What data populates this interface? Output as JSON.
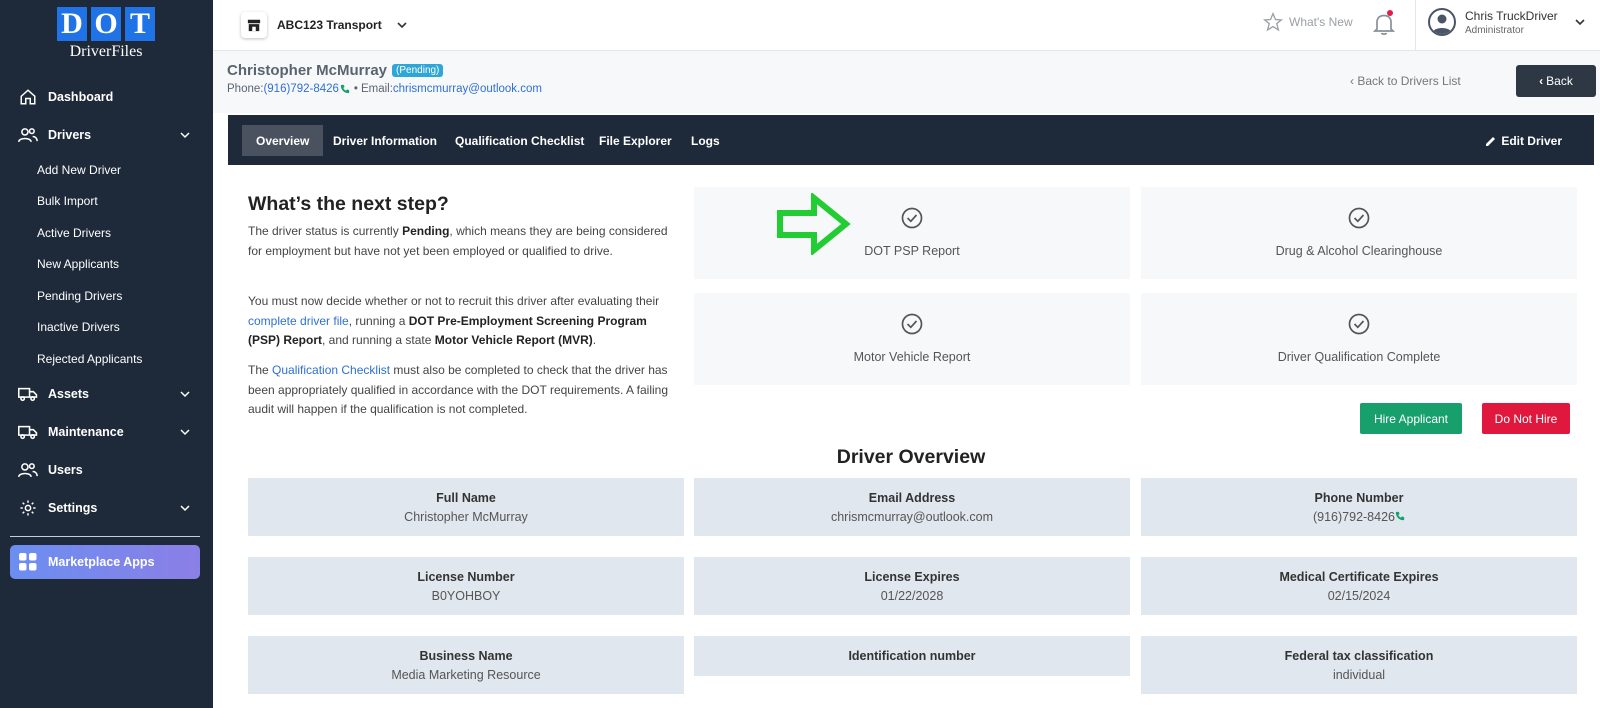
{
  "brand": {
    "letters": [
      "D",
      "O",
      "T"
    ],
    "sub": "DriverFiles"
  },
  "sidebar": {
    "dashboard": "Dashboard",
    "drivers": "Drivers",
    "drivers_sub": [
      "Add New Driver",
      "Bulk Import",
      "Active Drivers",
      "New Applicants",
      "Pending Drivers",
      "Inactive Drivers",
      "Rejected Applicants"
    ],
    "assets": "Assets",
    "maintenance": "Maintenance",
    "users": "Users",
    "settings": "Settings",
    "marketplace": "Marketplace Apps"
  },
  "topbar": {
    "company": "ABC123 Transport",
    "whats_new": "What's New",
    "user_name": "Chris TruckDriver",
    "user_role": "Administrator"
  },
  "driver": {
    "name": "Christopher McMurray",
    "status": "(Pending)",
    "phone_label": "Phone:",
    "phone": "(916)792-8426",
    "email_label": "Email:",
    "email": "chrismcmurray@outlook.com",
    "separator": "•"
  },
  "header": {
    "back_list": "Back to Drivers List",
    "back": "Back"
  },
  "tabs": [
    "Overview",
    "Driver Information",
    "Qualification Checklist",
    "File Explorer",
    "Logs"
  ],
  "edit_driver": "Edit Driver",
  "next_step": {
    "title": "What’s the next step?",
    "p1_a": "The driver status is currently ",
    "p1_b": "Pending",
    "p1_c": ", which means they are being considered for employment but have not yet been employed or qualified to drive.",
    "p2_a": "You must now decide whether or not to recruit this driver after evaluating their ",
    "p2_link": "complete driver file",
    "p2_b": ", running a ",
    "p2_bold1": "DOT Pre-Employment Screening Program (PSP) Report",
    "p2_c": ", and running a state ",
    "p2_bold2": "Motor Vehicle Report (MVR)",
    "p2_d": ".",
    "p3_a": "The ",
    "p3_link": "Qualification Checklist",
    "p3_b": " must also be completed to check that the driver has been appropriately qualified in accordance with the DOT requirements. A failing audit will happen if the qualification is not completed."
  },
  "steps": [
    "DOT PSP Report",
    "Drug & Alcohol Clearinghouse",
    "Motor Vehicle Report",
    "Driver Qualification Complete"
  ],
  "actions": {
    "hire": "Hire Applicant",
    "no_hire": "Do Not Hire"
  },
  "overview": {
    "title": "Driver Overview",
    "fields": [
      {
        "label": "Full Name",
        "value": "Christopher McMurray"
      },
      {
        "label": "Email Address",
        "value": "chrismcmurray@outlook.com"
      },
      {
        "label": "Phone Number",
        "value": "(916)792-8426"
      },
      {
        "label": "License Number",
        "value": "B0YOHBOY"
      },
      {
        "label": "License Expires",
        "value": "01/22/2028"
      },
      {
        "label": "Medical Certificate Expires",
        "value": "02/15/2024"
      },
      {
        "label": "Business Name",
        "value": "Media Marketing Resource"
      },
      {
        "label": "Identification number",
        "value": ""
      },
      {
        "label": "Federal tax classification",
        "value": "individual"
      }
    ]
  },
  "colors": {
    "sidebar": "#1e2a3a",
    "accent_link": "#2f6fd6",
    "hire": "#17a06b",
    "no_hire": "#e0183e",
    "arrow": "#22cc33"
  }
}
